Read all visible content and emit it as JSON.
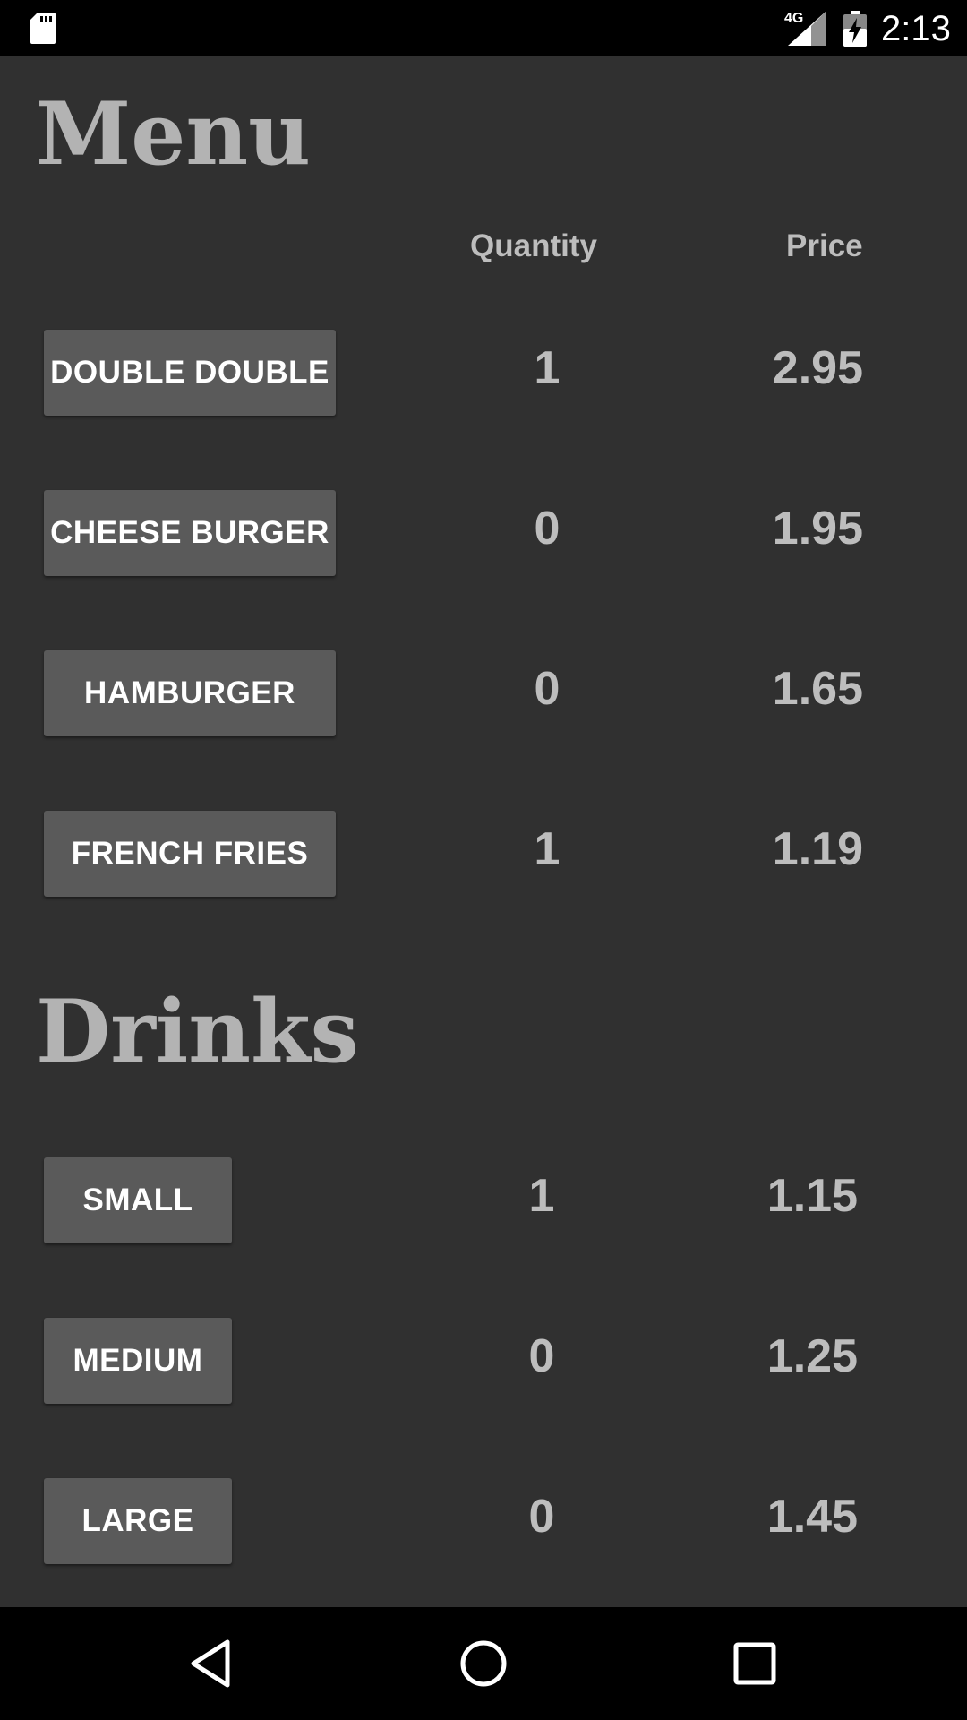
{
  "status_bar": {
    "network": "4G",
    "time": "2:13"
  },
  "menu": {
    "title": "Menu",
    "quantity_header": "Quantity",
    "price_header": "Price",
    "items": [
      {
        "label": "DOUBLE DOUBLE",
        "quantity": "1",
        "price": "2.95"
      },
      {
        "label": "CHEESE BURGER",
        "quantity": "0",
        "price": "1.95"
      },
      {
        "label": "HAMBURGER",
        "quantity": "0",
        "price": "1.65"
      },
      {
        "label": "FRENCH FRIES",
        "quantity": "1",
        "price": "1.19"
      }
    ]
  },
  "drinks": {
    "title": "Drinks",
    "items": [
      {
        "label": "SMALL",
        "quantity": "1",
        "price": "1.15"
      },
      {
        "label": "MEDIUM",
        "quantity": "0",
        "price": "1.25"
      },
      {
        "label": "LARGE",
        "quantity": "0",
        "price": "1.45"
      }
    ]
  },
  "nav_bar": {
    "icons": [
      "back-icon",
      "home-icon",
      "recents-icon"
    ]
  },
  "colors": {
    "background": "#303030",
    "button": "#5a5a5a",
    "text_muted": "#bdbdbd"
  }
}
